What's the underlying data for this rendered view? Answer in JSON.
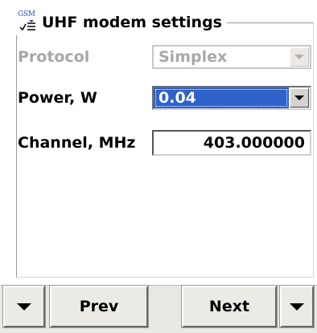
{
  "group": {
    "title": "UHF modem settings",
    "icon_text": "GSM",
    "icon": "gsm-settings-icon"
  },
  "fields": {
    "protocol": {
      "label": "Protocol",
      "value": "Simplex",
      "enabled": false
    },
    "power": {
      "label": "Power, W",
      "value": "0.04",
      "enabled": true
    },
    "channel": {
      "label": "Channel, MHz",
      "value": "403.000000"
    }
  },
  "bottom_bar": {
    "prev_label": "Prev",
    "next_label": "Next"
  },
  "colors": {
    "selection": "#2f62c9",
    "disabled_text": "#a8a8a8",
    "bar_bg": "#e9e8e3"
  }
}
